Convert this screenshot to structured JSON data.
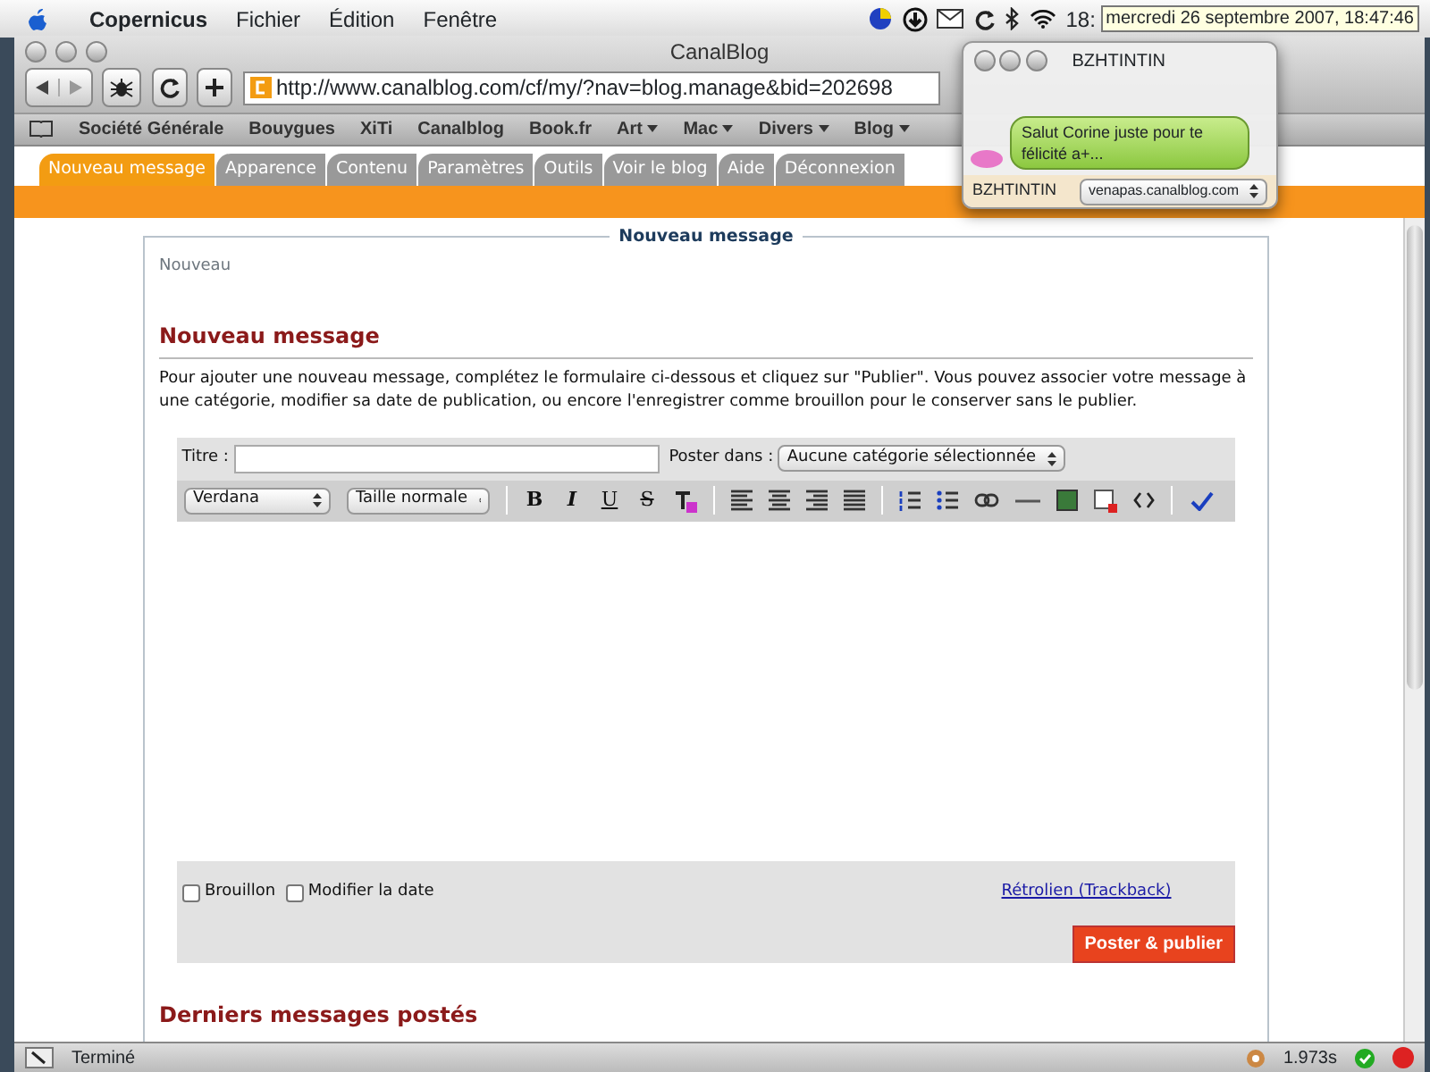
{
  "menubar": {
    "app": "Copernicus",
    "menus": [
      "Fichier",
      "Édition",
      "Fenêtre"
    ],
    "clock": "18:",
    "tooltip": "mercredi 26 septembre 2007, 18:47:46"
  },
  "browser": {
    "title": "CanalBlog",
    "url": "http://www.canalblog.com/cf/my/?nav=blog.manage&bid=202698",
    "bookmarks": [
      {
        "label": "Société Générale",
        "dropdown": false
      },
      {
        "label": "Bouygues",
        "dropdown": false
      },
      {
        "label": "XiTi",
        "dropdown": false
      },
      {
        "label": "Canalblog",
        "dropdown": false
      },
      {
        "label": "Book.fr",
        "dropdown": false
      },
      {
        "label": "Art",
        "dropdown": true
      },
      {
        "label": "Mac",
        "dropdown": true
      },
      {
        "label": "Divers",
        "dropdown": true
      },
      {
        "label": "Blog",
        "dropdown": true
      }
    ],
    "status": "Terminé",
    "load_time": "1.973s"
  },
  "tabs": [
    {
      "label": "Nouveau message",
      "selected": true
    },
    {
      "label": "Apparence",
      "selected": false
    },
    {
      "label": "Contenu",
      "selected": false
    },
    {
      "label": "Paramètres",
      "selected": false
    },
    {
      "label": "Outils",
      "selected": false
    },
    {
      "label": "Voir le blog",
      "selected": false
    },
    {
      "label": "Aide",
      "selected": false
    },
    {
      "label": "Déconnexion",
      "selected": false
    }
  ],
  "panel": {
    "legend": "Nouveau message",
    "breadcrumb": "Nouveau",
    "heading": "Nouveau message",
    "intro": "Pour ajouter une nouveau message, complétez le formulaire ci-dessous et cliquez sur \"Publier\". Vous pouvez associer votre message à une catégorie, modifier sa date de publication, ou encore l'enregistrer comme brouillon pour le conserver sans le publier.",
    "title_label": "Titre :",
    "category_label": "Poster dans :",
    "category": "Aucune catégorie sélectionnée",
    "font": "Verdana",
    "size": "Taille normale",
    "format_buttons": [
      "B",
      "I",
      "U",
      "S"
    ],
    "options": [
      {
        "label": "Brouillon",
        "checked": false
      },
      {
        "label": "Modifier la date",
        "checked": false
      }
    ],
    "trackback": "Rétrolien (Trackback)",
    "submit": "Poster & publier",
    "recent_heading": "Derniers messages postés"
  },
  "chat": {
    "title": "BZHTINTIN",
    "message": "Salut Corine juste pour te félicité a+...",
    "sender": "BZHTINTIN",
    "account": "venapas.canalblog.com"
  }
}
